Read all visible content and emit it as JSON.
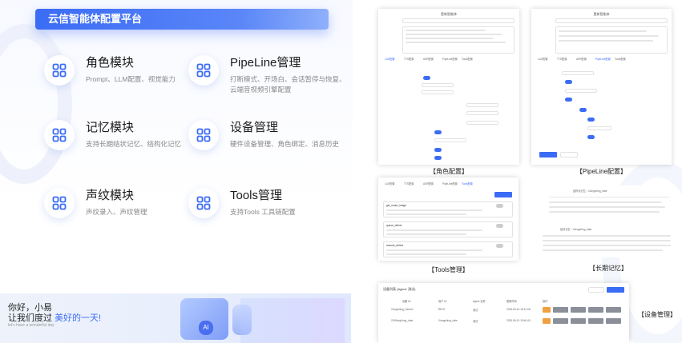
{
  "platform_title": "云信智能体配置平台",
  "modules": [
    {
      "title": "角色模块",
      "desc_lines": [
        "Prompt、LLM配置、视觉能力"
      ],
      "icon": "grid-icon"
    },
    {
      "title": "PipeLine管理",
      "desc_lines": [
        "打断模式、开场白、会话暂停与恢复、",
        "云端音视频引擎配置"
      ],
      "icon": "grid-icon"
    },
    {
      "title": "记忆模块",
      "desc_lines": [
        "支持长期结状记忆、结构化记忆"
      ],
      "icon": "grid-icon"
    },
    {
      "title": "设备管理",
      "desc_lines": [
        "硬件设备管理、角色绑定、消息历史"
      ],
      "icon": "grid-icon"
    },
    {
      "title": "声纹模块",
      "desc_lines": [
        "声纹录入、声纹管理"
      ],
      "icon": "grid-icon"
    },
    {
      "title": "Tools管理",
      "desc_lines": [
        "支持Tools 工具链配置"
      ],
      "icon": "grid-icon"
    }
  ],
  "banner": {
    "greeting_line1": "你好，小易",
    "greeting_line2_prefix": "让我们度过",
    "greeting_line2_highlight": "美好的一天!",
    "sub": "let's have a wonderful day"
  },
  "screenshots": {
    "role": {
      "caption": "【角色配置】",
      "header": "更新智能体",
      "tabs": [
        "LLM配置",
        "TTS配置",
        "ASR配置",
        "PipeLine配置",
        "Tools配置"
      ]
    },
    "pipeline": {
      "caption": "【PipeLine配置】",
      "header": "更新智能体",
      "tabs": [
        "LLM配置",
        "TTS配置",
        "ASR配置",
        "PipeLine配置",
        "Tools配置"
      ]
    },
    "tools": {
      "caption": "【Tools管理】",
      "tabs": [
        "LLM配置",
        "TTS配置",
        "ASR配置",
        "PipeLine配置",
        "Tools配置"
      ],
      "items": [
        "get_music_image",
        "queue_detect",
        "resume_detect"
      ]
    },
    "memory": {
      "caption": "【长期记忆】",
      "title1": "结构化记忆 - Xiongshing_date",
      "title2": "结状记忆 - Xiongshing_date"
    },
    "device": {
      "caption": "【设备管理】",
      "title": "设备列表 (Agent: 测试)",
      "columns": [
        "设备 ID",
        "用户 ID",
        "Agent 名称",
        "更新时间",
        "操作"
      ],
      "rows": [
        [
          "Xiongshing_Demo1",
          "REG1",
          "测试",
          "2025-06-10 15:12:08"
        ],
        [
          "ZhShingKung_date",
          "Xiongshing_date",
          "测试",
          "2025-06-10 19:40:40"
        ]
      ]
    }
  },
  "colors": {
    "accent": "#3b6cf5"
  }
}
